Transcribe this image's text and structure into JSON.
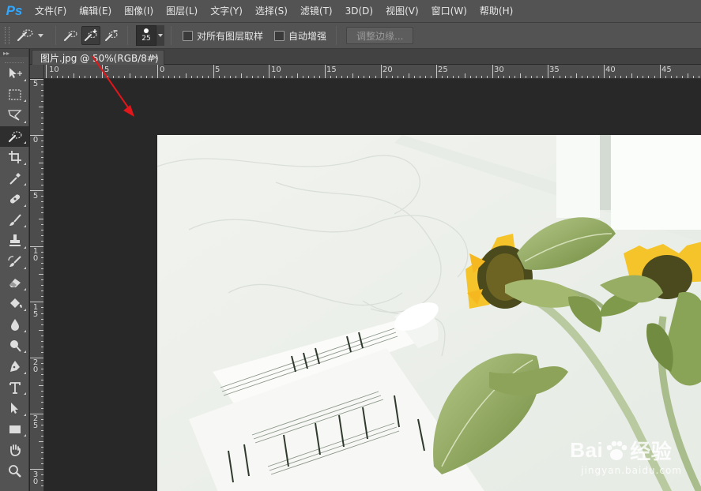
{
  "app": {
    "logo": "Ps"
  },
  "menu": [
    "文件(F)",
    "编辑(E)",
    "图像(I)",
    "图层(L)",
    "文字(Y)",
    "选择(S)",
    "滤镜(T)",
    "3D(D)",
    "视图(V)",
    "窗口(W)",
    "帮助(H)"
  ],
  "options": {
    "brush_size": "25",
    "sample_all_layers_label": "对所有图层取样",
    "auto_enhance_label": "自动增强",
    "refine_edge_label": "调整边缘..."
  },
  "toolbar": {
    "collapse_glyph": "▸▸"
  },
  "document": {
    "tab_title": "图片.jpg @ 50%(RGB/8#)",
    "close_glyph": "×"
  },
  "ruler": {
    "h_labels": [
      "10",
      "5",
      "0",
      "5",
      "10",
      "15",
      "20",
      "25",
      "30",
      "35",
      "40",
      "45"
    ],
    "v_labels": [
      [
        "5"
      ],
      [
        "0"
      ],
      [
        "5"
      ],
      [
        "1",
        "0"
      ],
      [
        "1",
        "5"
      ],
      [
        "2",
        "0"
      ],
      [
        "2",
        "5"
      ],
      [
        "3",
        "0"
      ]
    ]
  },
  "watermark": {
    "main": "Bai",
    "main2": "经验",
    "sub": "jingyan.baidu.com"
  },
  "colors": {
    "accent": "#31a8ff",
    "arrow": "#e3161b"
  }
}
